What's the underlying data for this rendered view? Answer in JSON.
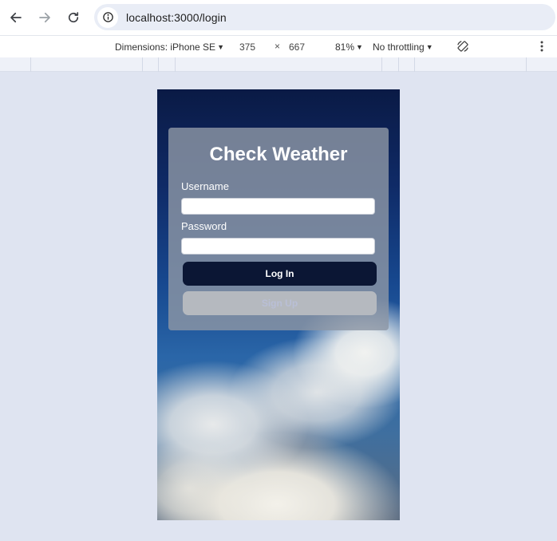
{
  "browser": {
    "url": "localhost:3000/login",
    "icons": {
      "back": "arrow-left-icon",
      "forward": "arrow-right-icon",
      "reload": "reload-icon",
      "site_info": "info-icon"
    }
  },
  "devtools": {
    "dimensions_label": "Dimensions: iPhone SE",
    "width": "375",
    "times": "×",
    "height": "667",
    "zoom": "81%",
    "throttling": "No throttling",
    "icons": {
      "rotate": "rotate-icon",
      "more": "more-vert-icon"
    }
  },
  "app": {
    "title": "Check Weather",
    "username_label": "Username",
    "username_value": "",
    "password_label": "Password",
    "password_value": "",
    "login_button": "Log In",
    "signup_button": "Sign Up"
  },
  "colors": {
    "page_background": "#dfe4f1",
    "login_button": "#0b1634",
    "signup_button": "#b5b9bf",
    "card": "#8c96a5"
  }
}
